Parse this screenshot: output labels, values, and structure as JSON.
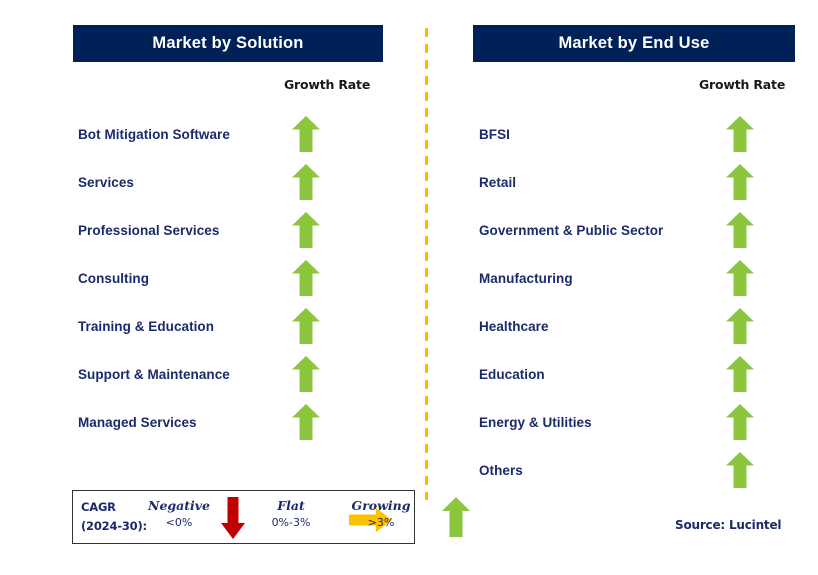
{
  "colors": {
    "header_bg": "#002158",
    "header_text": "#ffffff",
    "label_text": "#1b2a6b",
    "arrow_growing": "#8CC63F",
    "arrow_negative": "#C00000",
    "arrow_flat": "#FFC000",
    "divider": "#fcb900",
    "legend_border": "#333333",
    "page_bg": "#ffffff"
  },
  "panels": [
    {
      "id": "market-by-solution",
      "title": "Market by Solution",
      "growth_rate_label": "Growth Rate",
      "rows": [
        {
          "label": "Bot Mitigation Software",
          "trend": "growing"
        },
        {
          "label": "Services",
          "trend": "growing"
        },
        {
          "label": "Professional Services",
          "trend": "growing"
        },
        {
          "label": "Consulting",
          "trend": "growing"
        },
        {
          "label": "Training & Education",
          "trend": "growing"
        },
        {
          "label": "Support & Maintenance",
          "trend": "growing"
        },
        {
          "label": "Managed Services",
          "trend": "growing"
        }
      ]
    },
    {
      "id": "market-by-end-use",
      "title": "Market by End Use",
      "growth_rate_label": "Growth Rate",
      "rows": [
        {
          "label": "BFSI",
          "trend": "growing"
        },
        {
          "label": "Retail",
          "trend": "growing"
        },
        {
          "label": "Government & Public Sector",
          "trend": "growing"
        },
        {
          "label": "Manufacturing",
          "trend": "growing"
        },
        {
          "label": "Healthcare",
          "trend": "growing"
        },
        {
          "label": "Education",
          "trend": "growing"
        },
        {
          "label": "Energy & Utilities",
          "trend": "growing"
        },
        {
          "label": "Others",
          "trend": "growing"
        }
      ]
    }
  ],
  "legend": {
    "cagr_line1": "CAGR",
    "cagr_line2": "(2024-30):",
    "entries": [
      {
        "title": "Negative",
        "value": "<0%",
        "icon": "arrow-down-red-icon"
      },
      {
        "title": "Flat",
        "value": "0%-3%",
        "icon": "arrow-right-gold-icon"
      },
      {
        "title": "Growing",
        "value": ">3%",
        "icon": "arrow-up-green-icon"
      }
    ]
  },
  "source": "Source: Lucintel"
}
